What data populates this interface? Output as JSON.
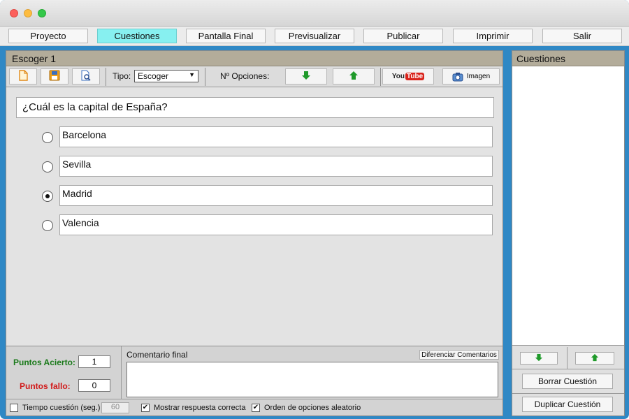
{
  "menu": {
    "items": [
      "Proyecto",
      "Cuestiones",
      "Pantalla Final",
      "Previsualizar",
      "Publicar",
      "Imprimir",
      "Salir"
    ],
    "active_index": 1
  },
  "editor": {
    "title": "Escoger 1",
    "toolbar": {
      "tipo_label": "Tipo:",
      "tipo_value": "Escoger",
      "opciones_label": "Nº Opciones:",
      "youtube_label": "YouTube",
      "imagen_label": "Imagen",
      "icons": [
        "new-file-icon",
        "save-icon",
        "preview-icon",
        "arrow-down-icon",
        "arrow-up-icon",
        "youtube-icon",
        "camera-icon"
      ]
    },
    "question": "¿Cuál es la capital de España?",
    "options": [
      {
        "text": "Barcelona",
        "selected": false
      },
      {
        "text": "Sevilla",
        "selected": false
      },
      {
        "text": "Madrid",
        "selected": true
      },
      {
        "text": "Valencia",
        "selected": false
      }
    ]
  },
  "footer": {
    "puntos_acierto_label": "Puntos Acierto:",
    "puntos_acierto_value": "1",
    "puntos_fallo_label": "Puntos fallo:",
    "puntos_fallo_value": "0",
    "comentario_label": "Comentario final",
    "diferenciar_label": "Diferenciar Comentarios",
    "tiempo_label": "Tiempo cuestión (seg.)",
    "tiempo_value": "60",
    "tiempo_checked": false,
    "mostrar_label": "Mostrar respuesta correcta",
    "mostrar_checked": true,
    "orden_label": "Orden de opciones aleatorio",
    "orden_checked": true
  },
  "side": {
    "title": "Cuestiones",
    "borrar_label": "Borrar Cuestión",
    "duplicar_label": "Duplicar Cuestión"
  },
  "colors": {
    "accent_blue": "#2f88c5",
    "active_tab": "#87f0f0",
    "header": "#b3ac9a",
    "green_label": "#1a7a1a",
    "red_label": "#d11a1a"
  }
}
